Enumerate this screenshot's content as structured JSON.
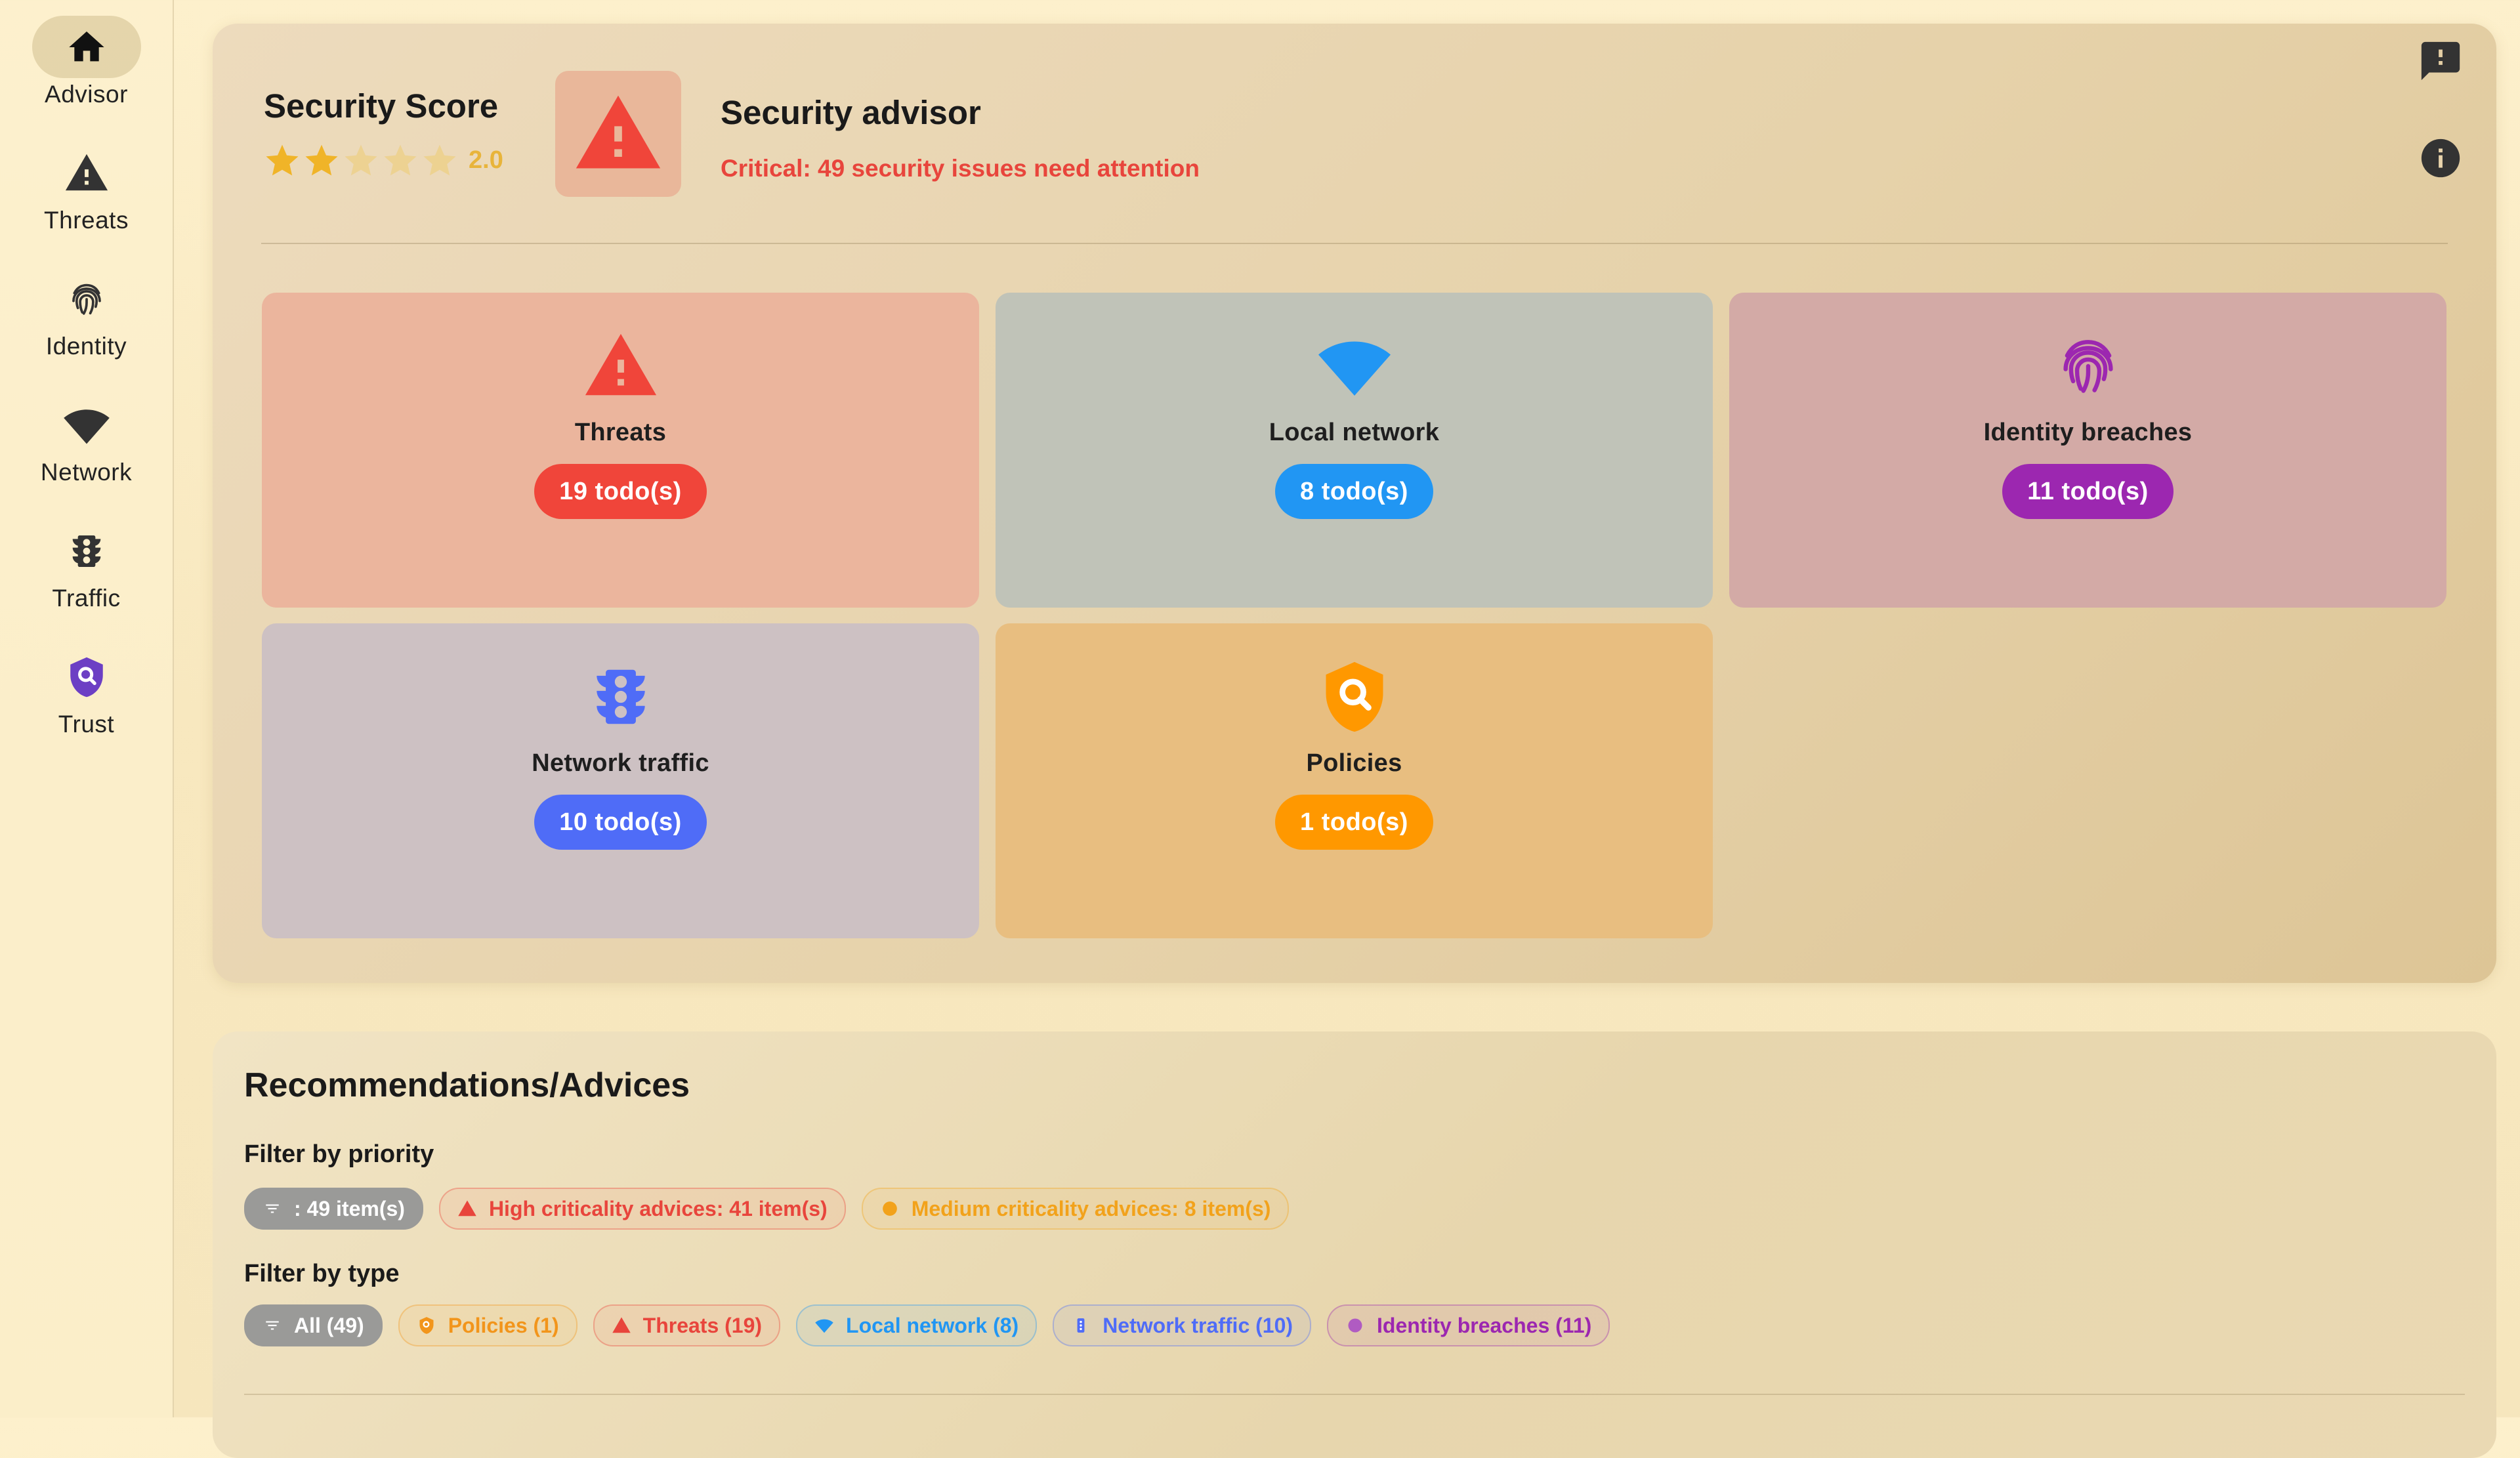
{
  "sidebar": {
    "items": [
      {
        "label": "Advisor",
        "icon": "home-icon",
        "active": true
      },
      {
        "label": "Threats",
        "icon": "warning-icon"
      },
      {
        "label": "Identity",
        "icon": "fingerprint-icon"
      },
      {
        "label": "Network",
        "icon": "wifi-icon"
      },
      {
        "label": "Traffic",
        "icon": "traffic-light-icon"
      },
      {
        "label": "Trust",
        "icon": "shield-search-icon"
      }
    ]
  },
  "score": {
    "title": "Security Score",
    "value": "2.0",
    "stars_filled": 2,
    "stars_total": 5
  },
  "advisor": {
    "title": "Security advisor",
    "subtitle": "Critical: 49 security issues need attention"
  },
  "tiles": [
    {
      "title": "Threats",
      "todo": "19 todo(s)",
      "color": "#f0453a",
      "bg": "#ebb49c",
      "icon": "warning-icon"
    },
    {
      "title": "Local network",
      "todo": "8 todo(s)",
      "color": "#2196f3",
      "bg": "#bfc3b8",
      "icon": "wifi-icon"
    },
    {
      "title": "Identity breaches",
      "todo": "11 todo(s)",
      "color": "#9c27b0",
      "bg": "#d3a9a5",
      "icon": "fingerprint-icon"
    },
    {
      "title": "Network traffic",
      "todo": "10 todo(s)",
      "color": "#4f6cf7",
      "bg": "#cdc0c2",
      "icon": "traffic-light-icon"
    },
    {
      "title": "Policies",
      "todo": "1 todo(s)",
      "color": "#ff9800",
      "bg": "#e8bd7e",
      "icon": "shield-search-icon"
    }
  ],
  "recommendations": {
    "title": "Recommendations/Advices",
    "priority_label": "Filter by priority",
    "type_label": "Filter by type",
    "priority_chips": [
      {
        "label": ": 49 item(s)",
        "icon": "filter-icon",
        "selected": true
      },
      {
        "label": "High criticality advices: 41 item(s)",
        "icon": "warning-icon",
        "color": "#e8453c"
      },
      {
        "label": "Medium criticality advices: 8 item(s)",
        "icon": "dot-icon",
        "color": "#f2a21b"
      }
    ],
    "type_chips": [
      {
        "label": "All (49)",
        "icon": "filter-icon",
        "selected": true
      },
      {
        "label": "Policies (1)",
        "icon": "shield-search-icon",
        "color": "#f2951b"
      },
      {
        "label": "Threats (19)",
        "icon": "warning-icon",
        "color": "#e8453c"
      },
      {
        "label": "Local network (8)",
        "icon": "wifi-icon",
        "color": "#2196f3"
      },
      {
        "label": "Network traffic (10)",
        "icon": "traffic-light-icon",
        "color": "#4f6cf7"
      },
      {
        "label": "Identity breaches (11)",
        "icon": "dot-icon",
        "color": "#9c27b0"
      }
    ]
  }
}
